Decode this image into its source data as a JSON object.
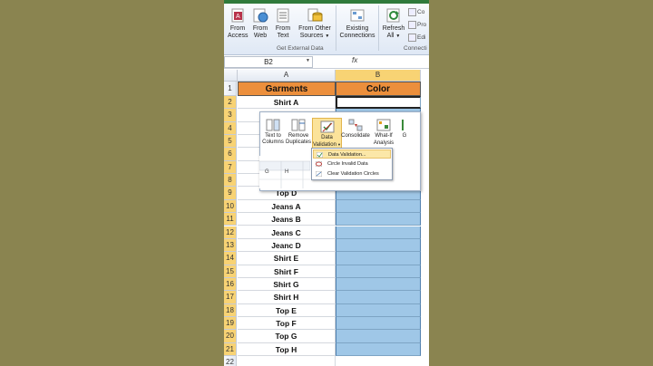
{
  "ribbon": {
    "buttons": [
      {
        "line1": "From",
        "line2": "Access"
      },
      {
        "line1": "From",
        "line2": "Web"
      },
      {
        "line1": "From",
        "line2": "Text"
      },
      {
        "line1": "From Other",
        "line2": "Sources"
      },
      {
        "line1": "Existing",
        "line2": "Connections"
      },
      {
        "line1": "Refresh",
        "line2": "All"
      }
    ],
    "group_label": "Get External Data",
    "side_items": [
      "Co",
      "Pro",
      "Edi"
    ],
    "connections_label": "Connecti"
  },
  "formula_bar": {
    "name_box": "B2",
    "fx": "fx"
  },
  "columns": [
    "A",
    "B"
  ],
  "rows": [
    {
      "n": "1",
      "a": "Garments",
      "b": "Color"
    },
    {
      "n": "2",
      "a": "Shirt A"
    },
    {
      "n": "3",
      "a": ""
    },
    {
      "n": "4",
      "a": ""
    },
    {
      "n": "5",
      "a": ""
    },
    {
      "n": "6",
      "a": ""
    },
    {
      "n": "7",
      "a": ""
    },
    {
      "n": "8",
      "a": ""
    },
    {
      "n": "9",
      "a": "Top D"
    },
    {
      "n": "10",
      "a": "Jeans A"
    },
    {
      "n": "11",
      "a": "Jeans B"
    },
    {
      "n": "12",
      "a": "Jeans C"
    },
    {
      "n": "13",
      "a": "Jeanc D"
    },
    {
      "n": "14",
      "a": "Shirt E"
    },
    {
      "n": "15",
      "a": "Shirt F"
    },
    {
      "n": "16",
      "a": "Shirt G"
    },
    {
      "n": "17",
      "a": "Shirt H"
    },
    {
      "n": "18",
      "a": "Top E"
    },
    {
      "n": "19",
      "a": "Top F"
    },
    {
      "n": "20",
      "a": "Top G"
    },
    {
      "n": "21",
      "a": "Top H"
    },
    {
      "n": "22",
      "a": ""
    }
  ],
  "popup": {
    "buttons": [
      {
        "line1": "Text to",
        "line2": "Columns"
      },
      {
        "line1": "Remove",
        "line2": "Duplicates"
      },
      {
        "line1": "Data",
        "line2": "Validation"
      },
      {
        "line1": "Consolidate",
        "line2": ""
      },
      {
        "line1": "What-If",
        "line2": "Analysis"
      },
      {
        "line1": "G",
        "line2": ""
      }
    ],
    "mini_cols": [
      "G",
      "H"
    ],
    "menu": [
      "Data Validation...",
      "Circle Invalid Data",
      "Clear Validation Circles"
    ]
  },
  "colors": {
    "header_fill": "#ec8f3c",
    "selection_fill": "#9fc7e7",
    "background": "#8a8450"
  }
}
